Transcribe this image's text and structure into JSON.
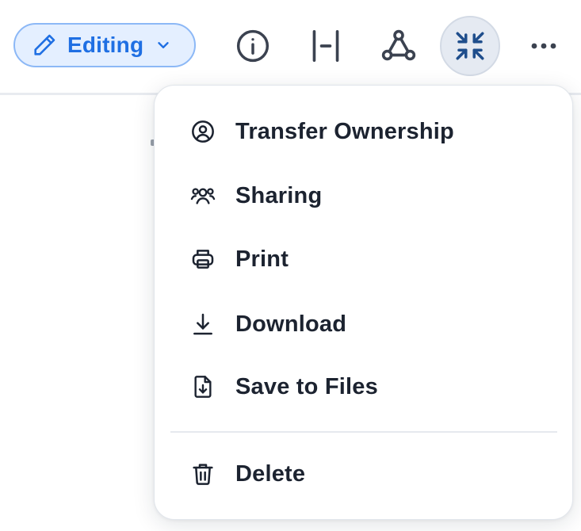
{
  "toolbar": {
    "mode_label": "Editing",
    "icons": [
      "pencil-icon",
      "chevron-down-icon",
      "info-icon",
      "split-icon",
      "collaborate-icon",
      "collapse-icon",
      "more-icon"
    ]
  },
  "menu": {
    "items": [
      {
        "label": "Transfer Ownership",
        "icon": "user-circle-icon"
      },
      {
        "label": "Sharing",
        "icon": "people-icon"
      },
      {
        "label": "Print",
        "icon": "printer-icon"
      },
      {
        "label": "Download",
        "icon": "download-icon"
      },
      {
        "label": "Save to Files",
        "icon": "file-download-icon"
      },
      {
        "label": "Delete",
        "icon": "trash-icon"
      }
    ]
  },
  "colors": {
    "accent": "#1f6fe3",
    "pill_bg": "#e4efff",
    "pill_border": "#8cb8f6",
    "icon": "#3b4250",
    "collapse_icon": "#1f4e8c",
    "menu_text": "#1c2330"
  }
}
